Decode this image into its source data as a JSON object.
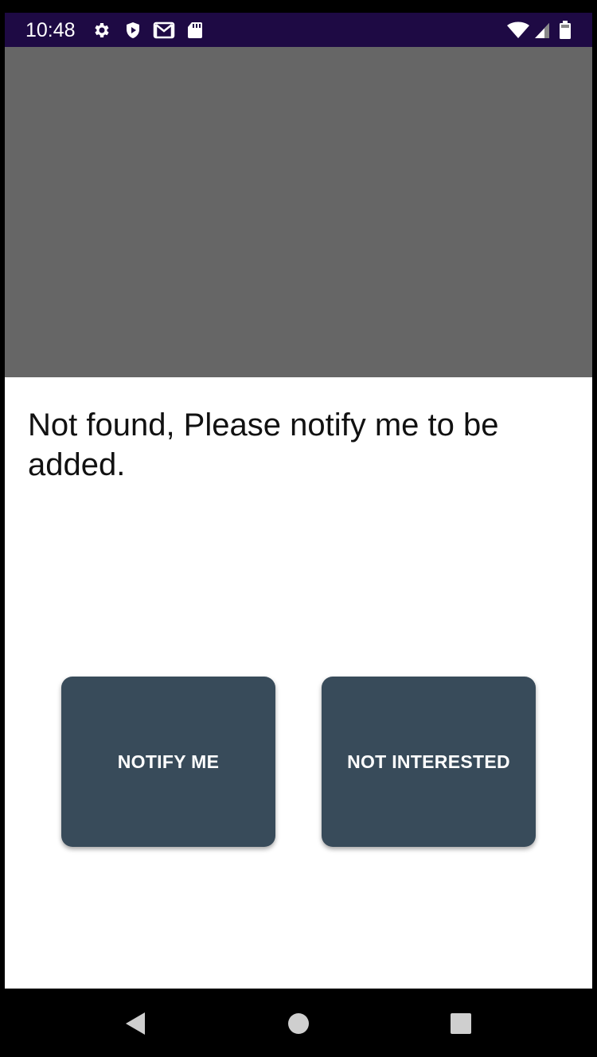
{
  "status_bar": {
    "time": "10:48",
    "background_color": "#1e0a44",
    "left_icons": [
      "settings-icon",
      "shield-icon",
      "gmail-icon",
      "sd-card-icon"
    ],
    "right_icons": [
      "wifi-icon",
      "cellular-signal-icon",
      "battery-icon"
    ]
  },
  "content": {
    "image_placeholder_color": "#666666",
    "message": "Not found, Please notify me to be added.",
    "buttons": {
      "notify_label": "NOTIFY ME",
      "not_interested_label": "NOT INTERESTED",
      "color": "#384b5a"
    }
  },
  "nav_bar": {
    "items": [
      "back-icon",
      "home-icon",
      "recents-icon"
    ]
  }
}
